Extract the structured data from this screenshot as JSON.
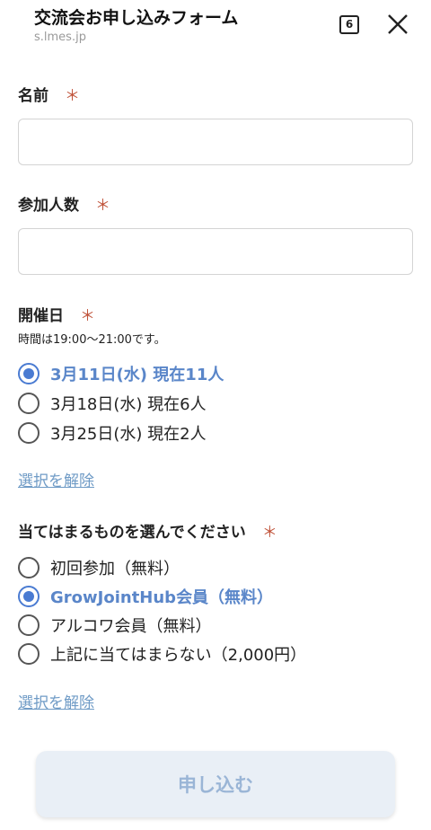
{
  "header": {
    "title": "交流会お申し込みフォーム",
    "domain": "s.lmes.jp",
    "tab_count": "6"
  },
  "form": {
    "required_mark": "＊",
    "name_label": "名前",
    "people_label": "参加人数",
    "date": {
      "label": "開催日",
      "hint": "時間は19:00〜21:00です。",
      "options": [
        {
          "label": "3月11日(水) 現在11人",
          "selected": true
        },
        {
          "label": "3月18日(水) 現在6人",
          "selected": false
        },
        {
          "label": "3月25日(水) 現在2人",
          "selected": false
        }
      ],
      "clear_label": "選択を解除"
    },
    "type": {
      "label": "当てはまるものを選んでください",
      "options": [
        {
          "label": "初回参加（無料）",
          "selected": false
        },
        {
          "label": "GrowJointHub会員（無料）",
          "selected": true
        },
        {
          "label": "アルコワ会員（無料）",
          "selected": false
        },
        {
          "label": "上記に当てはまらない（2,000円）",
          "selected": false
        }
      ],
      "clear_label": "選択を解除"
    },
    "submit_label": "申し込む"
  },
  "colors": {
    "accent": "#4a7bd2",
    "required": "#c0533a",
    "link": "#6f9bc6",
    "submit_bg": "#e9eff6"
  }
}
